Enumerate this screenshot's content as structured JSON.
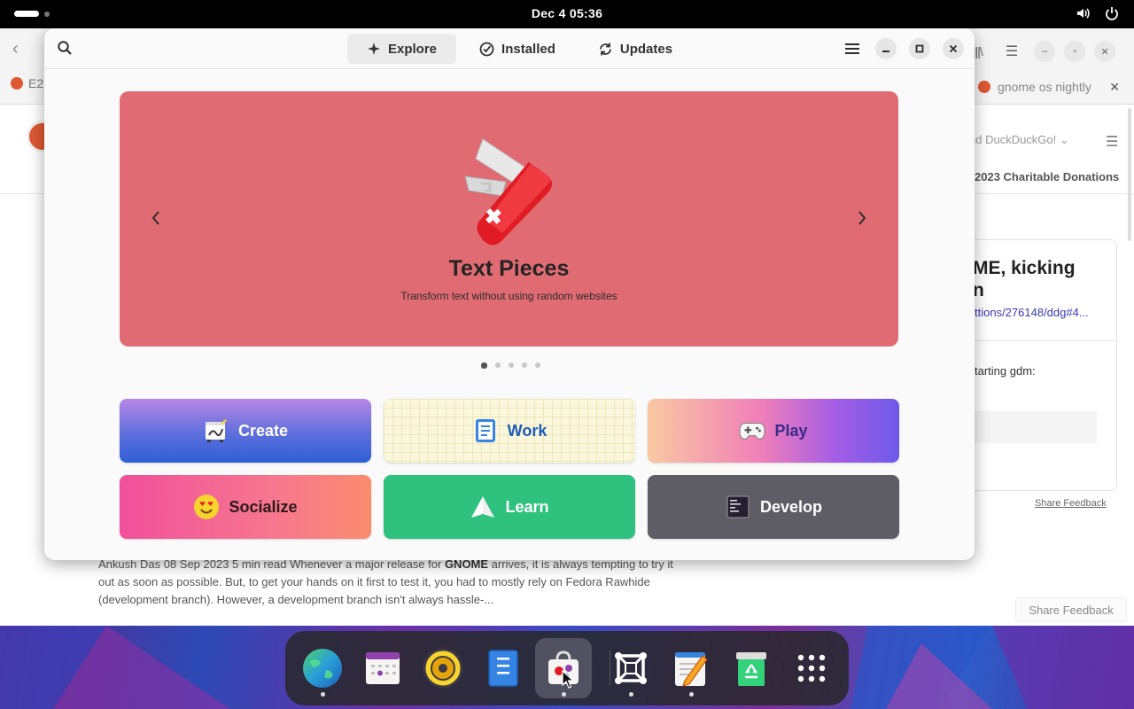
{
  "topbar": {
    "clock": "Dec 4  05:36"
  },
  "browser": {
    "tab_left_label": "E2",
    "tab_right_label": "gnome os nightly",
    "header_right_text": "nd DuckDuckGo!",
    "donations_text": "2023 Charitable Donations",
    "card_title_line1": "ME, kicking",
    "card_title_line2": "n",
    "card_link": "ttions/276148/ddg#4...",
    "card_text": "tarting gdm:",
    "share_feedback_link": "Share Feedback",
    "share_feedback_button": "Share Feedback",
    "article": {
      "part1": "Ankush Das 08 Sep 2023 5 min read Whenever a major release for ",
      "bold": "GNOME",
      "part2": " arrives, it is always tempting to try it out as soon as possible. But, to get your hands on it first to test it, you had to mostly rely on Fedora Rawhide (development branch). However, a development branch isn't always hassle-..."
    }
  },
  "software": {
    "tabs": [
      {
        "label": "Explore",
        "icon": "explore-icon",
        "active": true
      },
      {
        "label": "Installed",
        "icon": "check-circle-icon",
        "active": false
      },
      {
        "label": "Updates",
        "icon": "refresh-icon",
        "active": false
      }
    ],
    "featured": {
      "title": "Text Pieces",
      "subtitle": "Transform text without using random websites",
      "page_count": 5,
      "current_page": 1,
      "color": "#e06b73"
    },
    "categories": [
      {
        "label": "Create",
        "icon": "create-icon"
      },
      {
        "label": "Work",
        "icon": "work-icon"
      },
      {
        "label": "Play",
        "icon": "gamepad-icon"
      },
      {
        "label": "Socialize",
        "icon": "smiley-icon"
      },
      {
        "label": "Learn",
        "icon": "learn-icon"
      },
      {
        "label": "Develop",
        "icon": "terminal-icon"
      }
    ]
  },
  "dock": {
    "apps": [
      {
        "name": "web-browser",
        "running": true
      },
      {
        "name": "calendar",
        "running": false
      },
      {
        "name": "rhythmbox",
        "running": false
      },
      {
        "name": "text-pieces",
        "running": false
      },
      {
        "name": "software",
        "running": true,
        "active": true
      },
      {
        "name": "boxes",
        "running": true
      },
      {
        "name": "text-editor",
        "running": true
      },
      {
        "name": "trash",
        "running": false
      },
      {
        "name": "app-grid",
        "running": false
      }
    ]
  }
}
